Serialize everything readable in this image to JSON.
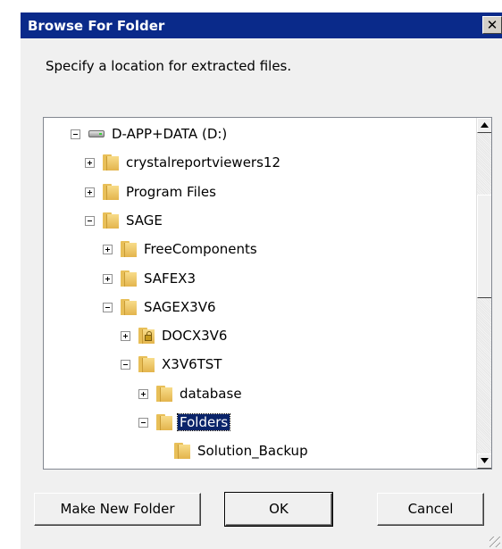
{
  "window": {
    "title": "Browse For Folder",
    "close_glyph": "✕"
  },
  "prompt": "Specify a location for extracted files.",
  "tree": [
    {
      "label": "D-APP+DATA (D:)",
      "icon": "drive-icon",
      "expander": "minus",
      "selected": false
    },
    {
      "label": "crystalreportviewers12",
      "icon": "folder-icon",
      "expander": "plus",
      "selected": false
    },
    {
      "label": "Program Files",
      "icon": "folder-icon",
      "expander": "plus",
      "selected": false
    },
    {
      "label": "SAGE",
      "icon": "folder-icon",
      "expander": "minus",
      "selected": false
    },
    {
      "label": "FreeComponents",
      "icon": "folder-icon",
      "expander": "plus",
      "selected": false
    },
    {
      "label": "SAFEX3",
      "icon": "folder-icon",
      "expander": "plus",
      "selected": false
    },
    {
      "label": "SAGEX3V6",
      "icon": "folder-icon",
      "expander": "minus",
      "selected": false
    },
    {
      "label": "DOCX3V6",
      "icon": "locked-folder-icon",
      "expander": "plus",
      "selected": false
    },
    {
      "label": "X3V6TST",
      "icon": "folder-icon",
      "expander": "minus",
      "selected": false
    },
    {
      "label": "database",
      "icon": "folder-icon",
      "expander": "plus",
      "selected": false
    },
    {
      "label": "Folders",
      "icon": "folder-icon",
      "expander": "minus",
      "selected": true
    },
    {
      "label": "Solution_Backup",
      "icon": "folder-icon",
      "expander": "none",
      "selected": false
    }
  ],
  "buttons": {
    "make_new_folder": "Make New Folder",
    "ok": "OK",
    "cancel": "Cancel"
  },
  "colors": {
    "titlebar": "#0a2a8a",
    "selection": "#0a246a",
    "dialog_bg": "#f0f0f0"
  }
}
